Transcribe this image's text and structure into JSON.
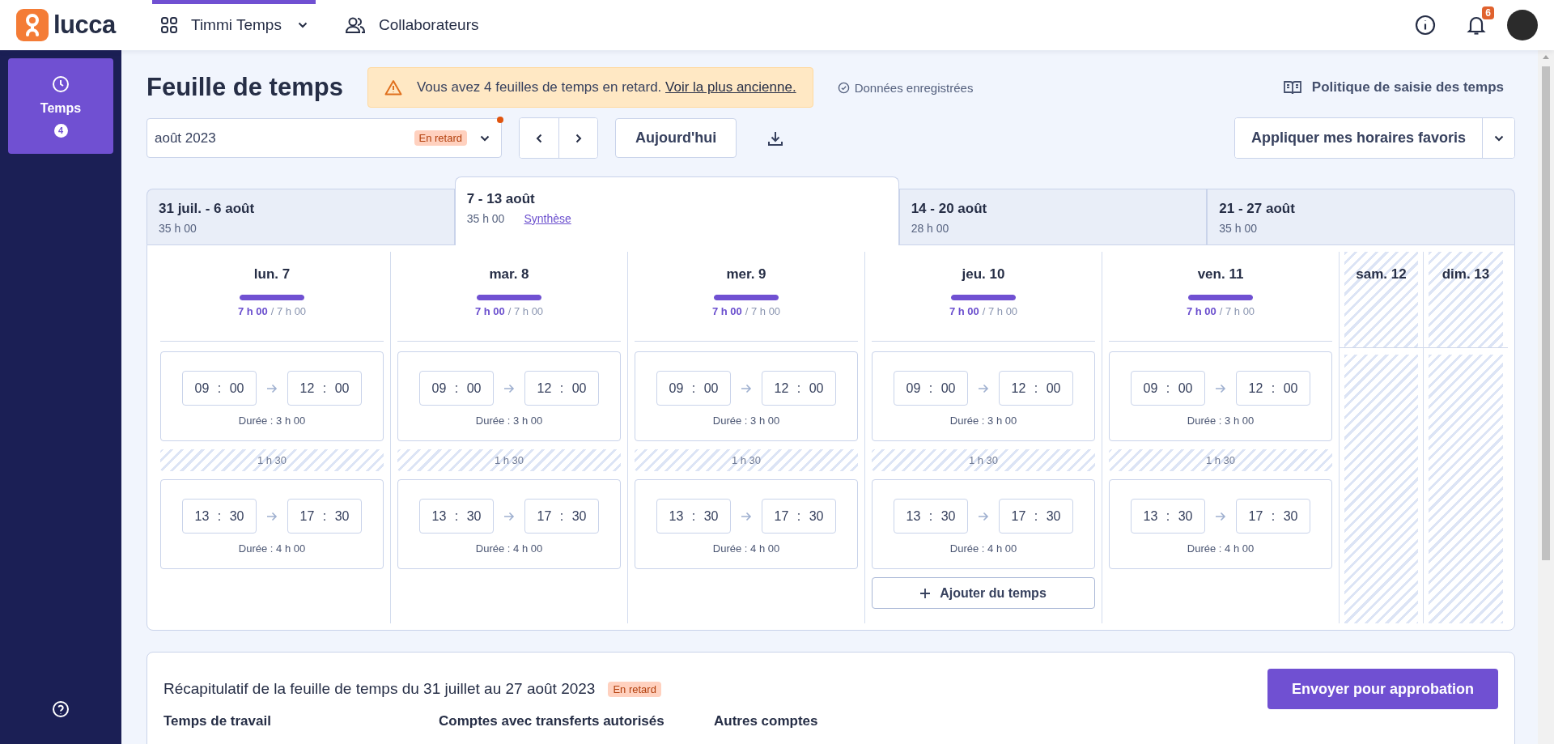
{
  "app": {
    "logo_text": "lucca"
  },
  "nav": [
    {
      "kind": "dropdown",
      "label": "Timmi Temps",
      "selected": true
    },
    {
      "kind": "link",
      "label": "Collaborateurs",
      "selected": false
    }
  ],
  "notifications": {
    "count": "6"
  },
  "sidebar": {
    "items": [
      {
        "label": "Temps",
        "badge": "4",
        "selected": true
      }
    ]
  },
  "page": {
    "title": "Feuille de temps"
  },
  "alert": {
    "message": "Vous avez 4 feuilles de temps en retard. ",
    "link": "Voir la plus ancienne."
  },
  "save_status": "Données enregistrées",
  "policy_link": "Politique de saisie des temps",
  "date_picker": {
    "value": "août 2023",
    "badge": "En retard",
    "alert_dot": true
  },
  "today_button": "Aujourd'hui",
  "favorites_button": "Appliquer mes horaires favoris",
  "weeks": [
    {
      "label": "31 juil. - 6 août",
      "total": "35 h 00",
      "selected": false
    },
    {
      "label": "7 - 13 août",
      "total": "35 h 00",
      "link": "Synthèse",
      "selected": true
    },
    {
      "label": "14 - 20 août",
      "total": "28 h 00",
      "selected": false
    },
    {
      "label": "21 - 27 août",
      "total": "35 h 00",
      "selected": false
    }
  ],
  "days": [
    {
      "kind": "workday",
      "label": "lun. 7",
      "level": 1,
      "worked": "7 h 00",
      "expected": "/ 7 h 00",
      "entries": [
        {
          "start": "09 : 00",
          "end": "12 : 00",
          "duration": "Durée : 3 h 00"
        },
        {
          "start": "13 : 30",
          "end": "17 : 30",
          "duration": "Durée : 4 h 00"
        }
      ],
      "breaks": [
        "1 h 30"
      ]
    },
    {
      "kind": "workday",
      "label": "mar. 8",
      "level": 1,
      "worked": "7 h 00",
      "expected": "/ 7 h 00",
      "entries": [
        {
          "start": "09 : 00",
          "end": "12 : 00",
          "duration": "Durée : 3 h 00"
        },
        {
          "start": "13 : 30",
          "end": "17 : 30",
          "duration": "Durée : 4 h 00"
        }
      ],
      "breaks": [
        "1 h 30"
      ]
    },
    {
      "kind": "workday",
      "label": "mer. 9",
      "level": 1,
      "worked": "7 h 00",
      "expected": "/ 7 h 00",
      "entries": [
        {
          "start": "09 : 00",
          "end": "12 : 00",
          "duration": "Durée : 3 h 00"
        },
        {
          "start": "13 : 30",
          "end": "17 : 30",
          "duration": "Durée : 4 h 00"
        }
      ],
      "breaks": [
        "1 h 30"
      ]
    },
    {
      "kind": "workday",
      "label": "jeu. 10",
      "level": 1,
      "worked": "7 h 00",
      "expected": "/ 7 h 00",
      "entries": [
        {
          "start": "09 : 00",
          "end": "12 : 00",
          "duration": "Durée : 3 h 00"
        },
        {
          "start": "13 : 30",
          "end": "17 : 30",
          "duration": "Durée : 4 h 00"
        }
      ],
      "breaks": [
        "1 h 30"
      ],
      "add_button": "Ajouter du temps"
    },
    {
      "kind": "workday",
      "label": "ven. 11",
      "level": 1,
      "worked": "7 h 00",
      "expected": "/ 7 h 00",
      "entries": [
        {
          "start": "09 : 00",
          "end": "12 : 00",
          "duration": "Durée : 3 h 00"
        },
        {
          "start": "13 : 30",
          "end": "17 : 30",
          "duration": "Durée : 4 h 00"
        }
      ],
      "breaks": [
        "1 h 30"
      ]
    },
    {
      "kind": "weekend",
      "label": "sam. 12"
    },
    {
      "kind": "weekend",
      "label": "dim. 13"
    }
  ],
  "summary": {
    "title": "Récapitulatif de la feuille de temps du 31 juillet au 27 août 2023",
    "badge": "En retard",
    "submit_button": "Envoyer pour approbation",
    "columns": [
      "Temps de travail",
      "Comptes avec transferts autorisés",
      "Autres comptes"
    ]
  }
}
